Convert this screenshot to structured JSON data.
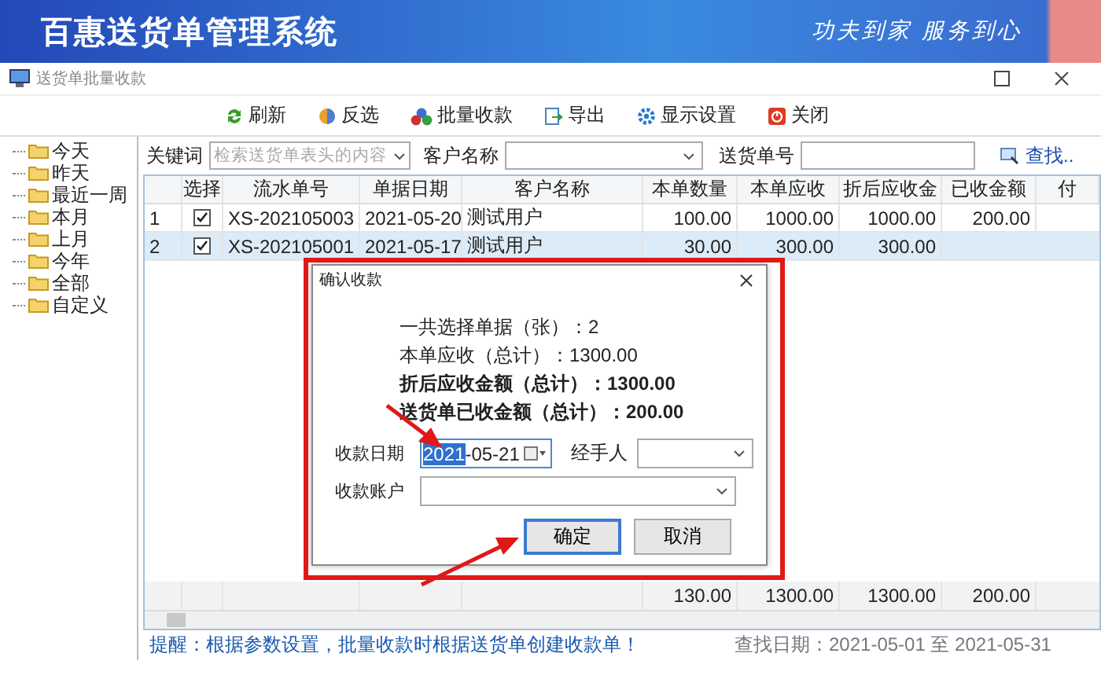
{
  "header": {
    "title": "百惠送货单管理系统",
    "slogan": "功夫到家 服务到心"
  },
  "window": {
    "title": "送货单批量收款"
  },
  "toolbar": [
    "刷新",
    "反选",
    "批量收款",
    "导出",
    "显示设置",
    "关闭"
  ],
  "tree": [
    {
      "label": "今天"
    },
    {
      "label": "昨天"
    },
    {
      "label": "最近一周"
    },
    {
      "label": "本月"
    },
    {
      "label": "上月"
    },
    {
      "label": "今年"
    },
    {
      "label": "全部"
    },
    {
      "label": "自定义"
    }
  ],
  "filters": {
    "keyword_label": "关键词",
    "keyword_placeholder": "检索送货单表头的内容",
    "customer_label": "客户名称",
    "number_label": "送货单号",
    "search_link": "查找.."
  },
  "table": {
    "columns": [
      "",
      "选择",
      "流水单号",
      "单据日期",
      "客户名称",
      "本单数量",
      "本单应收",
      "折后应收金",
      "已收金额",
      "付"
    ],
    "rows": [
      {
        "checked": true,
        "selected": false,
        "cells": [
          "1",
          "",
          "XS-202105003",
          "2021-05-20",
          "测试用户",
          "100.00",
          "1000.00",
          "1000.00",
          "200.00"
        ]
      },
      {
        "checked": true,
        "selected": true,
        "cells": [
          "2",
          "",
          "XS-202105001",
          "2021-05-17",
          "测试用户",
          "30.00",
          "300.00",
          "300.00"
        ]
      }
    ],
    "totals": [
      "130.00",
      "1300.00",
      "1300.00",
      "200.00"
    ]
  },
  "status": {
    "hint": "提醒：根据参数设置，批量收款时根据送货单创建收款单！",
    "range": "查找日期：2021-05-01 至 2021-05-31"
  },
  "dialog": {
    "title": "确认收款",
    "summary": [
      {
        "text": "一共选择单据（张）：2",
        "bold": false
      },
      {
        "text": "本单应收（总计）：1300.00",
        "bold": false
      },
      {
        "text": "折后应收金额（总计）：1300.00",
        "bold": true
      },
      {
        "text": "送货单已收金额（总计）：200.00",
        "bold": true
      }
    ],
    "date_label": "收款日期",
    "date_selected": "2021",
    "date_rest": "-05-21",
    "handler_label": "经手人",
    "account_label": "收款账户",
    "buttons": [
      {
        "label": "确定",
        "focused": true
      },
      {
        "label": "取消",
        "focused": false
      }
    ]
  }
}
